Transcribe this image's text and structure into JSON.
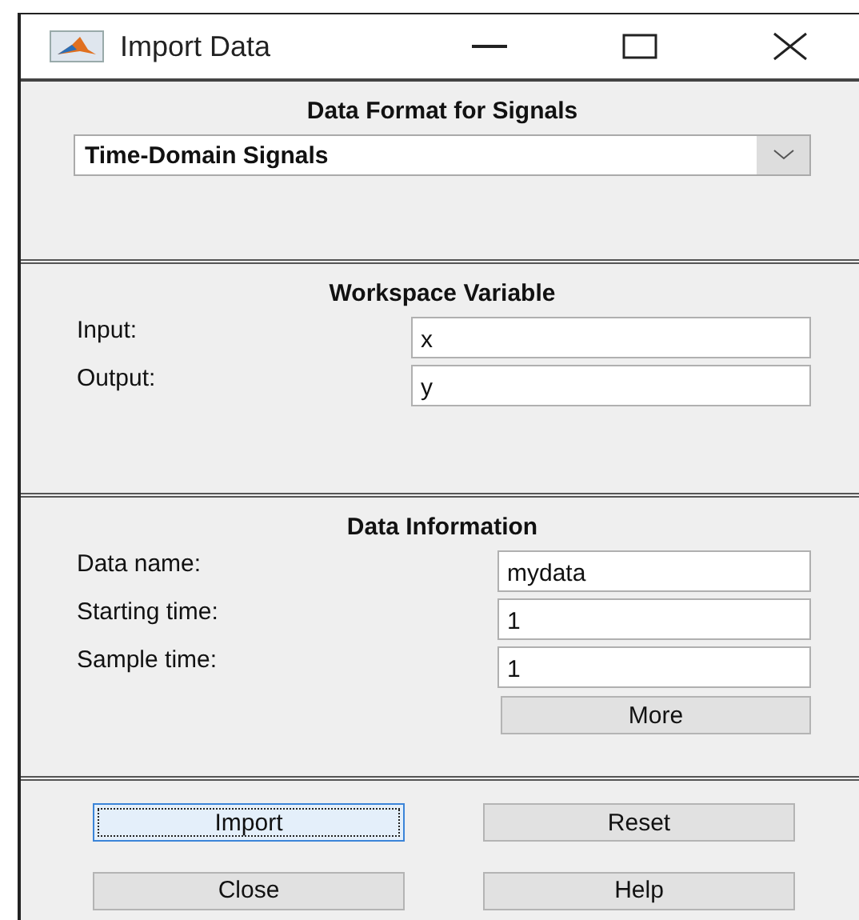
{
  "window": {
    "title": "Import Data"
  },
  "format_panel": {
    "title": "Data Format for Signals",
    "dropdown": {
      "value": "Time-Domain Signals"
    }
  },
  "workspace_panel": {
    "title": "Workspace Variable",
    "fields": [
      {
        "label": "Input:",
        "value": "x"
      },
      {
        "label": "Output:",
        "value": "y"
      }
    ]
  },
  "info_panel": {
    "title": "Data Information",
    "fields": [
      {
        "label": "Data name:",
        "value": "mydata"
      },
      {
        "label": "Starting time:",
        "value": "1"
      },
      {
        "label": "Sample time:",
        "value": "1"
      }
    ],
    "more_button": "More"
  },
  "buttons": [
    {
      "label": "Import",
      "focused": true
    },
    {
      "label": "Reset",
      "focused": false
    },
    {
      "label": "Close",
      "focused": false
    },
    {
      "label": "Help",
      "focused": false
    }
  ]
}
